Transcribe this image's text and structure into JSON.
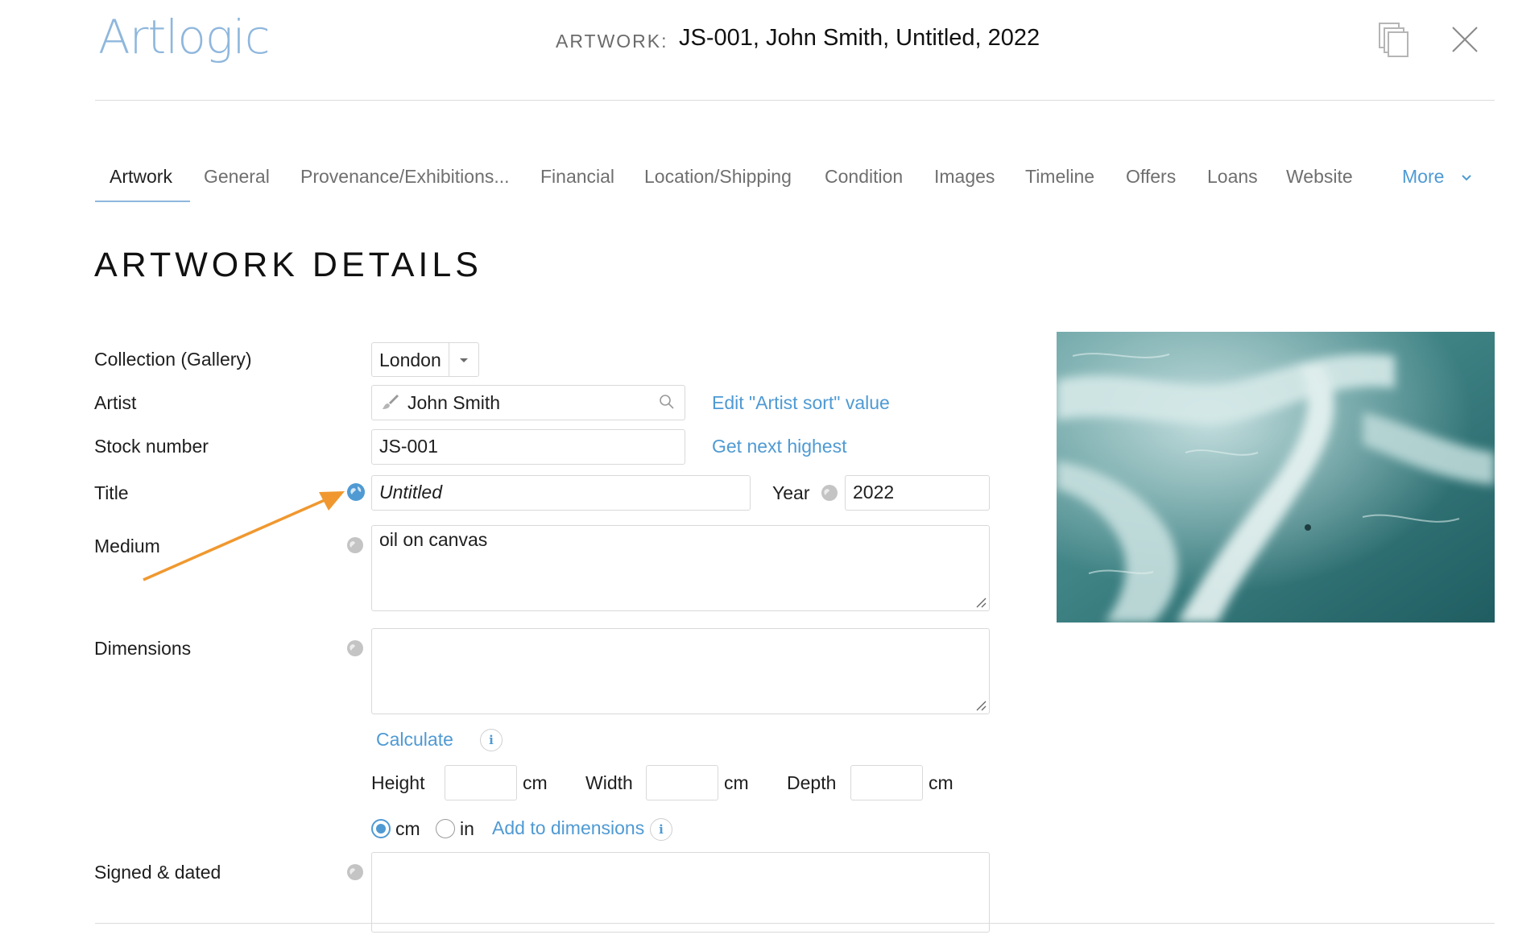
{
  "header": {
    "logo": "Artlogic",
    "label": "ARTWORK:",
    "title": "JS-001, John Smith, Untitled, 2022"
  },
  "tabs": [
    {
      "label": "Artwork",
      "active": true
    },
    {
      "label": "General"
    },
    {
      "label": "Provenance/Exhibitions..."
    },
    {
      "label": "Financial"
    },
    {
      "label": "Location/Shipping"
    },
    {
      "label": "Condition"
    },
    {
      "label": "Images"
    },
    {
      "label": "Timeline"
    },
    {
      "label": "Offers"
    },
    {
      "label": "Loans"
    },
    {
      "label": "Website"
    },
    {
      "label": "More"
    }
  ],
  "section_title": "ARTWORK DETAILS",
  "form": {
    "collection": {
      "label": "Collection (Gallery)",
      "value": "London"
    },
    "artist": {
      "label": "Artist",
      "value": "John Smith",
      "link": "Edit \"Artist sort\" value"
    },
    "stock": {
      "label": "Stock number",
      "value": "JS-001",
      "link": "Get next highest"
    },
    "title": {
      "label": "Title",
      "value": "Untitled"
    },
    "year": {
      "label": "Year",
      "value": "2022"
    },
    "medium": {
      "label": "Medium",
      "value": "oil on canvas"
    },
    "dimensions": {
      "label": "Dimensions",
      "value": "",
      "calculate": "Calculate",
      "height_label": "Height",
      "width_label": "Width",
      "depth_label": "Depth",
      "unit": "cm",
      "height": "",
      "width": "",
      "depth": "",
      "radio_cm": "cm",
      "radio_in": "in",
      "selected_unit": "cm",
      "add_link": "Add to dimensions"
    },
    "signed": {
      "label": "Signed & dated",
      "value": ""
    }
  },
  "colors": {
    "accent": "#4f9ad3",
    "annotation_arrow": "#f0982f",
    "logo": "#8fb7dd"
  }
}
